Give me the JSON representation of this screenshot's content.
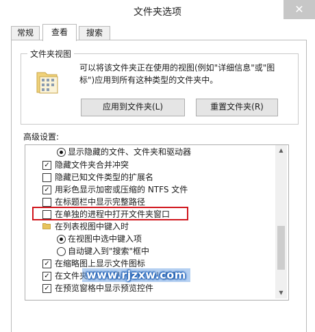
{
  "window": {
    "title": "文件夹选项",
    "close_glyph": "✕"
  },
  "tabs": [
    {
      "label": "常规",
      "active": false
    },
    {
      "label": "查看",
      "active": true
    },
    {
      "label": "搜索",
      "active": false
    }
  ],
  "folder_views": {
    "legend": "文件夹视图",
    "description": "可以将该文件夹正在使用的视图(例如\"详细信息\"或\"图标\")应用到所有这种类型的文件夹中。",
    "apply_button": "应用到文件夹(L)",
    "reset_button": "重置文件夹(R)"
  },
  "advanced": {
    "label": "高级设置:",
    "items": [
      {
        "type": "radio",
        "checked": true,
        "label": "显示隐藏的文件、文件夹和驱动器"
      },
      {
        "type": "checkbox",
        "checked": true,
        "label": "隐藏文件夹合并冲突"
      },
      {
        "type": "checkbox",
        "checked": false,
        "label": "隐藏已知文件类型的扩展名"
      },
      {
        "type": "checkbox",
        "checked": true,
        "label": "用彩色显示加密或压缩的 NTFS 文件"
      },
      {
        "type": "checkbox",
        "checked": false,
        "label": "在标题栏中显示完整路径"
      },
      {
        "type": "checkbox",
        "checked": false,
        "label": "在单独的进程中打开文件夹窗口",
        "highlighted": true
      },
      {
        "type": "folder",
        "label": "在列表视图中键入时"
      },
      {
        "type": "radio",
        "checked": true,
        "label": "在视图中选中键入项"
      },
      {
        "type": "radio",
        "checked": false,
        "label": "自动键入到\"搜索\"框中"
      },
      {
        "type": "checkbox",
        "checked": true,
        "label": "在缩略图上显示文件图标"
      },
      {
        "type": "checkbox",
        "checked": true,
        "label": "在文件夹提示中显示文件大小信息"
      },
      {
        "type": "checkbox",
        "checked": true,
        "label": "在预览窗格中显示预览控件"
      }
    ]
  },
  "watermark": "www.rjzxw.com",
  "colors": {
    "highlight": "#d0141b",
    "watermark": "#1c5fb8"
  }
}
